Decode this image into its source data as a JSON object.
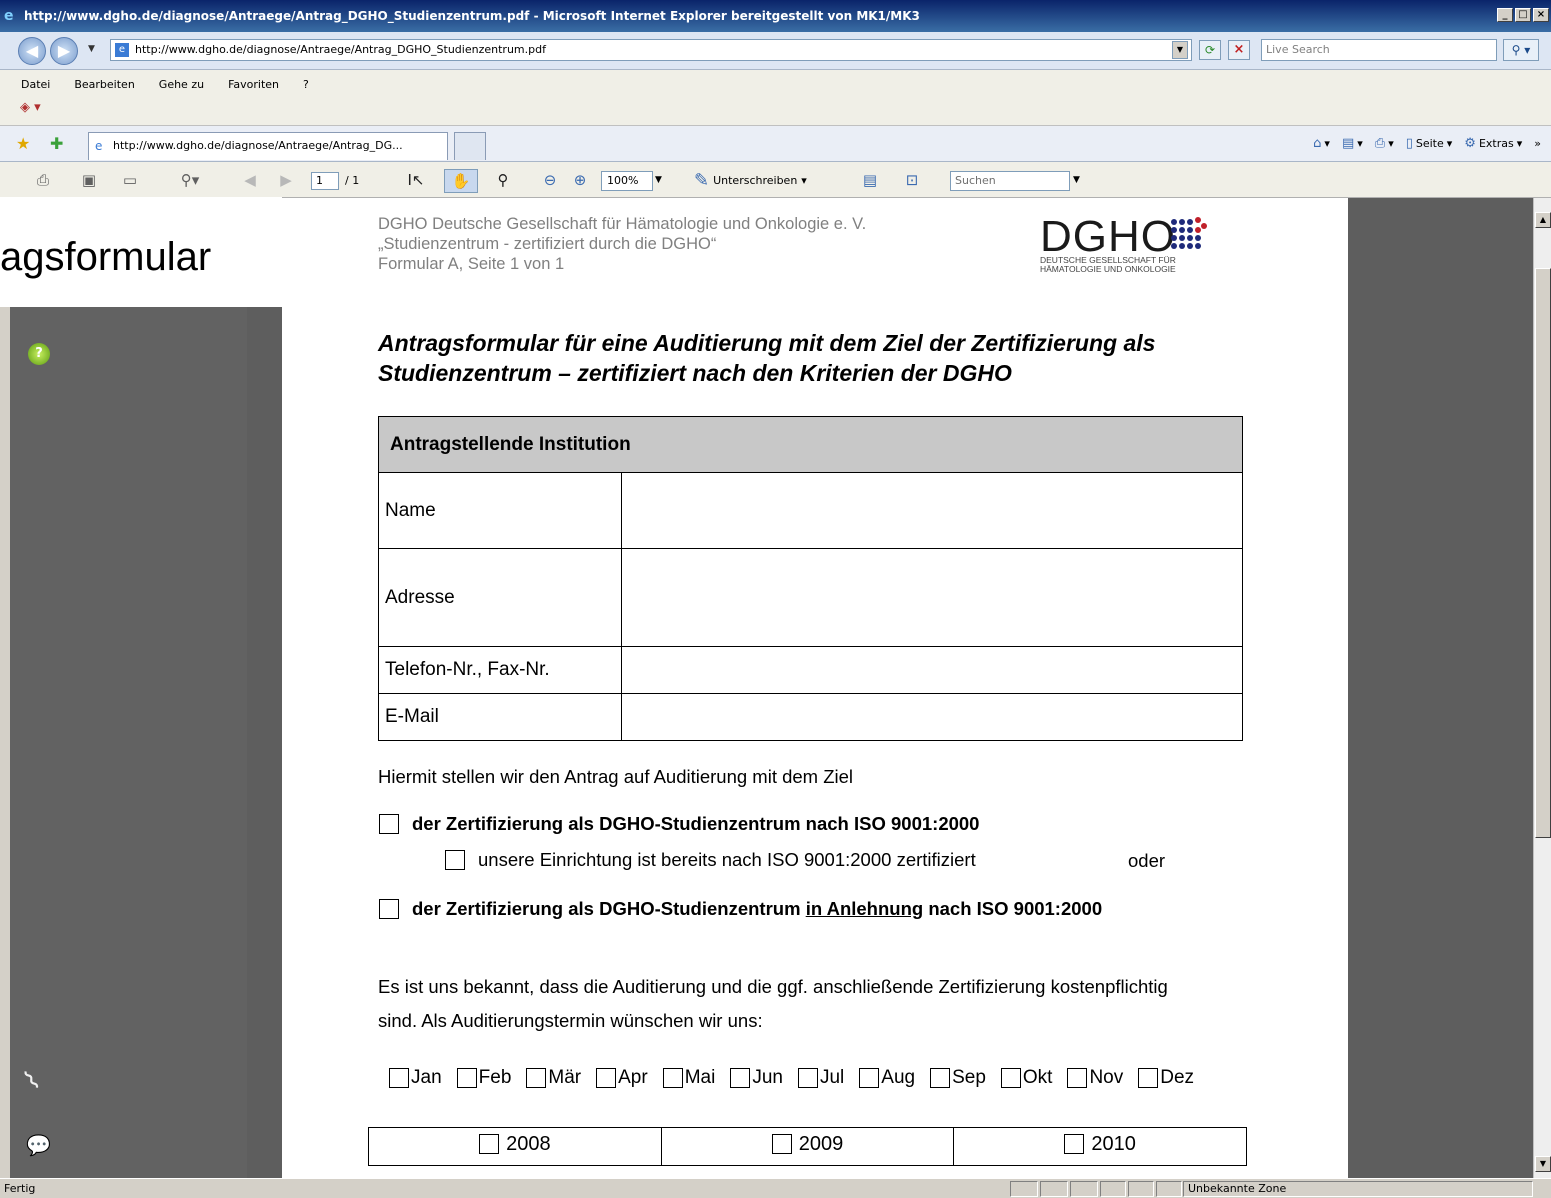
{
  "window": {
    "title": "http://www.dgho.de/diagnose/Antraege/Antrag_DGHO_Studienzentrum.pdf - Microsoft Internet Explorer bereitgestellt von MK1/MK3"
  },
  "address_bar": {
    "url": "http://www.dgho.de/diagnose/Antraege/Antrag_DGHO_Studienzentrum.pdf",
    "search_placeholder": "Live Search"
  },
  "menu": {
    "items": [
      "Datei",
      "Bearbeiten",
      "Gehe zu",
      "Favoriten",
      "?"
    ]
  },
  "tabs": {
    "active_label": "http://www.dgho.de/diagnose/Antraege/Antrag_DG..."
  },
  "command_bar": {
    "page_label": "Seite",
    "tools_label": "Extras"
  },
  "pdf_toolbar": {
    "page_current": "1",
    "page_total": "/ 1",
    "zoom": "100%",
    "sign_label": "Unterschreiben",
    "search_placeholder": "Suchen"
  },
  "overlay": {
    "text": "agsformular"
  },
  "document": {
    "header_lines": [
      "DGHO Deutsche Gesellschaft für Hämatologie und Onkologie e. V.",
      "„Studienzentrum - zertifiziert durch die DGHO“",
      "Formular A, Seite 1 von 1"
    ],
    "logo": {
      "text": "DGHO",
      "subtitle_line1": "DEUTSCHE GESELLSCHAFT FÜR",
      "subtitle_line2": "HÄMATOLOGIE UND ONKOLOGIE"
    },
    "title_line1": "Antragsformular für eine Auditierung mit dem Ziel der Zertifizierung als",
    "title_line2": "Studienzentrum – zertifiziert nach den Kriterien der DGHO",
    "institution_table": {
      "header": "Antragstellende Institution",
      "rows": [
        "Name",
        "Adresse",
        "Telefon-Nr., Fax-Nr.",
        "E-Mail"
      ]
    },
    "intro": "Hiermit stellen wir den Antrag auf Auditierung mit dem Ziel",
    "option1": "der Zertifizierung als DGHO-Studienzentrum nach ISO 9001:2000",
    "option1_sub": "unsere Einrichtung ist bereits nach ISO 9001:2000 zertifiziert",
    "option1_or": "oder",
    "option2_pre": "der Zertifizierung als DGHO-Studienzentrum ",
    "option2_underlined": "in Anlehnung",
    "option2_post": " nach ISO 9001:2000",
    "cost_line1": "Es ist uns bekannt, dass die Auditierung und die ggf. anschließende Zertifizierung kostenpflichtig",
    "cost_line2": "sind. Als Auditierungstermin wünschen wir uns:",
    "months": [
      "Jan",
      "Feb",
      "Mär",
      "Apr",
      "Mai",
      "Jun",
      "Jul",
      "Aug",
      "Sep",
      "Okt",
      "Nov",
      "Dez"
    ],
    "years": [
      "2008",
      "2009",
      "2010"
    ]
  },
  "status_bar": {
    "status": "Fertig",
    "zone": "Unbekannte Zone"
  }
}
